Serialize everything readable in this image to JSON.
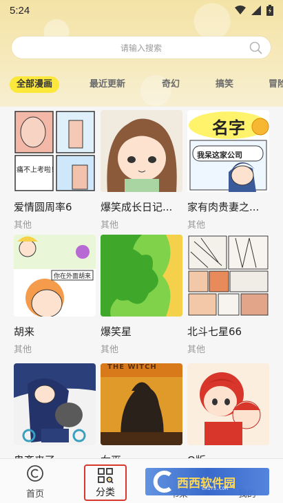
{
  "status": {
    "time": "5:24"
  },
  "search": {
    "placeholder": "请输入搜索"
  },
  "tabs": [
    {
      "label": "全部漫画",
      "active": true
    },
    {
      "label": "最近更新",
      "active": false
    },
    {
      "label": "奇幻",
      "active": false
    },
    {
      "label": "搞笑",
      "active": false
    },
    {
      "label": "冒险",
      "active": false
    }
  ],
  "comics": [
    {
      "title": "爱情圆周率6",
      "genre": "其他",
      "bubble": "痛不上考啦！"
    },
    {
      "title": "爆笑成长日记...",
      "genre": "其他"
    },
    {
      "title": "家有肉贵妻之...",
      "genre": "其他",
      "bubble_top": "名字",
      "bubble": "我呆这家公司"
    },
    {
      "title": "胡来",
      "genre": "其他",
      "bubble": "你在外面胡来"
    },
    {
      "title": "爆笑星",
      "genre": "其他"
    },
    {
      "title": "北斗七星66",
      "genre": "其他"
    },
    {
      "title": "鬼斋来了",
      "genre": "其他"
    },
    {
      "title": "女巫",
      "genre": "其他",
      "cover_text": "THE WITCH"
    },
    {
      "title": "Q版",
      "genre": "其他"
    }
  ],
  "bottom_nav": {
    "home": "首页",
    "category": "分类",
    "bookshelf": "书架",
    "mine": "我的"
  },
  "watermark": {
    "brand": "西西软件园",
    "url": "CR173.COM"
  },
  "colors": {
    "tab_active": "#fbe83a",
    "selected_border": "#d9362b",
    "header_bg": "#f4e3a6"
  }
}
